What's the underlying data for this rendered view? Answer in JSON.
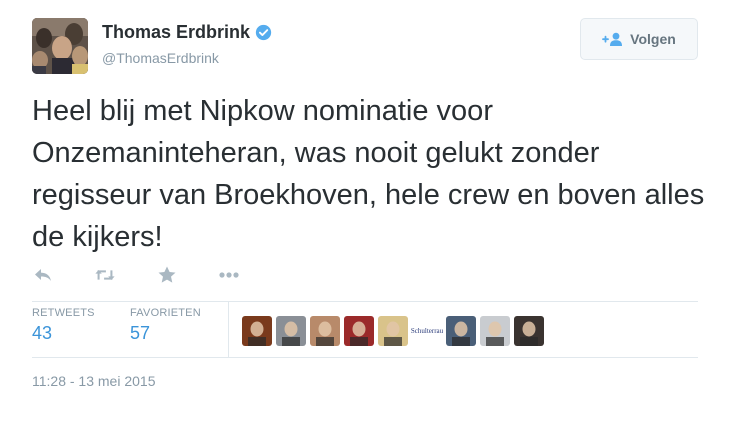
{
  "author": {
    "name": "Thomas Erdbrink",
    "handle": "@ThomasErdbrink",
    "verified": true
  },
  "follow_button": {
    "label": "Volgen",
    "icon": "follow-person-plus-icon"
  },
  "tweet": {
    "text": "Heel blij met Nipkow nominatie voor Onzemaninteheran, was nooit gelukt zonder regisseur van Broekhoven, hele crew en boven alles de kijkers!"
  },
  "actions": [
    {
      "name": "reply",
      "icon": "reply-icon"
    },
    {
      "name": "retweet",
      "icon": "retweet-icon"
    },
    {
      "name": "favorite",
      "icon": "star-icon"
    },
    {
      "name": "more",
      "icon": "more-icon"
    }
  ],
  "stats": {
    "retweets_label": "RETWEETS",
    "retweets_count": "43",
    "favorites_label": "FAVORIETEN",
    "favorites_count": "57"
  },
  "favoriter_avatars": [
    {
      "kind": "photo",
      "color": "#7a3a1c"
    },
    {
      "kind": "photo",
      "color": "#8a8f96"
    },
    {
      "kind": "photo",
      "color": "#b88a6a"
    },
    {
      "kind": "photo",
      "color": "#9b2a2a"
    },
    {
      "kind": "photo",
      "color": "#d9c38a"
    },
    {
      "kind": "text",
      "text": "Schulterrau"
    },
    {
      "kind": "photo",
      "color": "#4a5f78"
    },
    {
      "kind": "photo",
      "color": "#c9ccd0"
    },
    {
      "kind": "photo",
      "color": "#3a3330"
    }
  ],
  "timestamp": "11:28 - 13 mei 2015",
  "colors": {
    "link_blue": "#3b94d9",
    "verified_blue": "#55acee",
    "muted_gray": "#8899a6",
    "action_gray": "#aab8c2"
  }
}
